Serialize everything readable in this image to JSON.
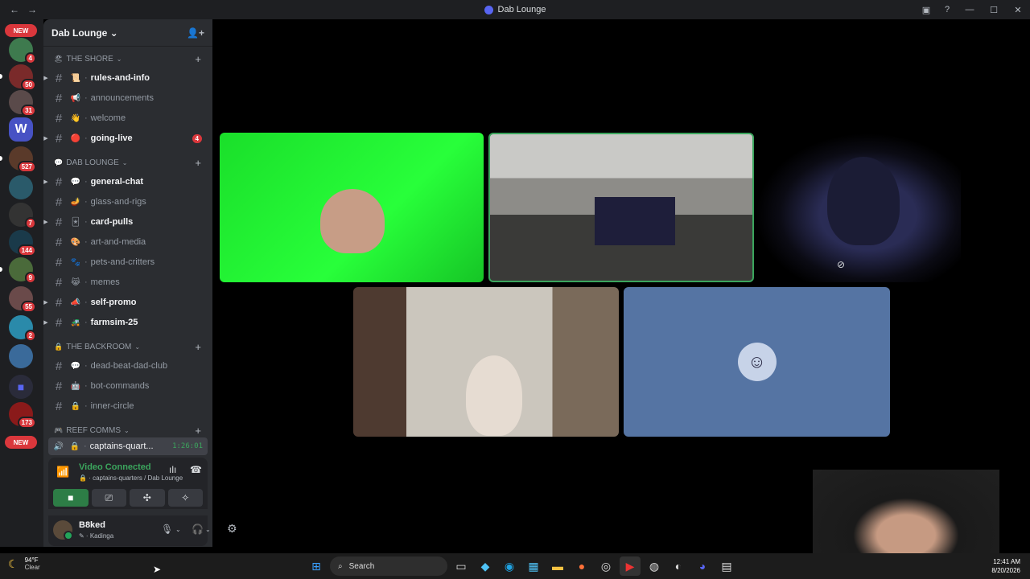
{
  "window": {
    "title": "Dab Lounge",
    "nav_back": "←",
    "nav_forward": "→"
  },
  "servers": {
    "new_label": "NEW",
    "badges": [
      "4",
      "50",
      "31",
      "527",
      "7",
      "144",
      "9",
      "55",
      "2",
      "173"
    ]
  },
  "server": {
    "name": "Dab Lounge",
    "chevron": "⌄"
  },
  "categories": [
    {
      "name": "THE SHORE",
      "icon": "🏖",
      "channels": [
        {
          "name": "rules-and-info",
          "emoji": "📜",
          "unread": true,
          "mention": ""
        },
        {
          "name": "announcements",
          "emoji": "📢",
          "unread": false,
          "mention": ""
        },
        {
          "name": "welcome",
          "emoji": "👋",
          "unread": false,
          "mention": ""
        },
        {
          "name": "going-live",
          "emoji": "🔴",
          "unread": true,
          "mention": "4"
        }
      ]
    },
    {
      "name": "DAB LOUNGE",
      "icon": "💬",
      "channels": [
        {
          "name": "general-chat",
          "emoji": "💬",
          "unread": true,
          "mention": ""
        },
        {
          "name": "glass-and-rigs",
          "emoji": "🪔",
          "unread": false,
          "mention": ""
        },
        {
          "name": "card-pulls",
          "emoji": "🃏",
          "unread": true,
          "mention": ""
        },
        {
          "name": "art-and-media",
          "emoji": "🎨",
          "unread": false,
          "mention": ""
        },
        {
          "name": "pets-and-critters",
          "emoji": "🐾",
          "unread": false,
          "mention": ""
        },
        {
          "name": "memes",
          "emoji": "😹",
          "unread": false,
          "mention": ""
        },
        {
          "name": "self-promo",
          "emoji": "📣",
          "unread": true,
          "mention": ""
        },
        {
          "name": "farmsim-25",
          "emoji": "🚜",
          "unread": true,
          "mention": ""
        }
      ]
    },
    {
      "name": "THE BACKROOM",
      "icon": "🔒",
      "channels": [
        {
          "name": "dead-beat-dad-club",
          "emoji": "💬",
          "unread": false,
          "mention": ""
        },
        {
          "name": "bot-commands",
          "emoji": "🤖",
          "unread": false,
          "mention": ""
        },
        {
          "name": "inner-circle",
          "emoji": "🔒",
          "unread": false,
          "mention": ""
        }
      ]
    },
    {
      "name": "REEF COMMS",
      "icon": "🎮",
      "channels": []
    }
  ],
  "active_voice": {
    "name": "captains-quart...",
    "timer": "1:26:01"
  },
  "voice": {
    "status": "Video Connected",
    "location": "captains-quarters / Dab Lounge"
  },
  "user": {
    "name": "B8ked",
    "status": "Kadinga"
  },
  "taskbar": {
    "weather_temp": "94°F",
    "weather_cond": "Clear",
    "search_label": "Search",
    "time": "12:41 AM",
    "date": "8/20/2026"
  },
  "colors": {
    "accent": "#5865f2",
    "connected": "#3ba55d",
    "mention": "#da373c",
    "sidebar": "#2b2d31"
  }
}
